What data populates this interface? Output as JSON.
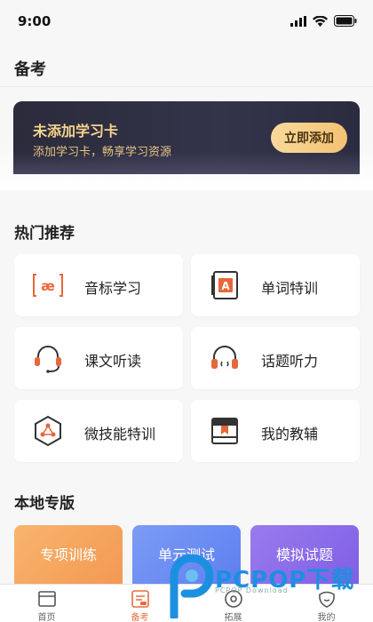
{
  "status_bar": {
    "time": "9:00"
  },
  "header": {
    "title": "备考"
  },
  "banner": {
    "title": "未添加学习卡",
    "subtitle": "添加学习卡，畅享学习资源",
    "button_label": "立即添加",
    "colors": {
      "background": "#2b2b3c",
      "title": "#f5d48c",
      "button": "#f3c274"
    }
  },
  "hot": {
    "title": "热门推荐",
    "items": [
      {
        "label": "音标学习",
        "icon": "phonetic-ae-icon"
      },
      {
        "label": "单词特训",
        "icon": "word-card-a-icon"
      },
      {
        "label": "课文听读",
        "icon": "headset-mic-icon"
      },
      {
        "label": "话题听力",
        "icon": "headphones-icon"
      },
      {
        "label": "微技能特训",
        "icon": "hexagon-skill-icon"
      },
      {
        "label": "我的教辅",
        "icon": "book-icon"
      }
    ]
  },
  "local": {
    "title": "本地专版",
    "items": [
      {
        "label": "专项训练",
        "color": "#f6a35c"
      },
      {
        "label": "单元测试",
        "color": "#6f8df3"
      },
      {
        "label": "模拟试题",
        "color": "#8f6ee8"
      }
    ]
  },
  "tabs": [
    {
      "label": "首页",
      "icon": "home-icon",
      "active": false
    },
    {
      "label": "备考",
      "icon": "exam-icon",
      "active": true
    },
    {
      "label": "拓展",
      "icon": "disc-icon",
      "active": false
    },
    {
      "label": "我的",
      "icon": "profile-icon",
      "active": false
    }
  ],
  "watermark": {
    "brand": "PCPOP下载",
    "sub": "PCPOP Download"
  },
  "accent": "#e86b3c"
}
